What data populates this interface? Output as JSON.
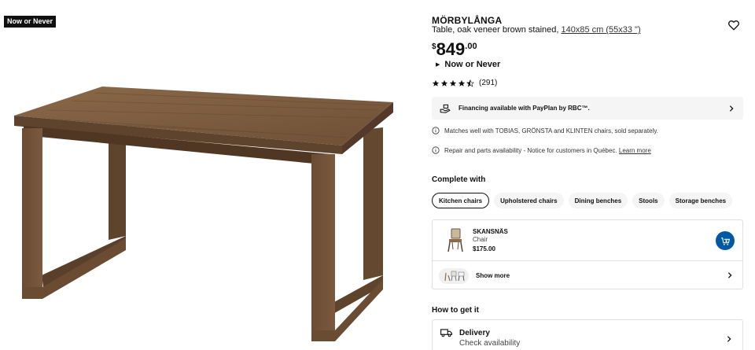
{
  "gallery": {
    "badge": "Now or Never"
  },
  "product": {
    "name": "MÖRBYLÅNGA",
    "description": "Table, oak veneer brown stained, ",
    "measure": "140x85 cm (55x33 \")",
    "price_currency": "$",
    "price_integer": "849",
    "price_decimal": ".00",
    "offer_label": "Now or Never",
    "rating_value": 4.5,
    "rating_count": "(291)"
  },
  "financing": {
    "label": "Financing available with PayPlan by RBC™."
  },
  "notes": {
    "matches": "Matches well with TOBIAS, GRÖNSTA and KLINTEN chairs, sold separately.",
    "repair": "Repair and parts availability - Notice for customers in Québec. ",
    "repair_link": "Learn more"
  },
  "complete_with": {
    "title": "Complete with",
    "chips": [
      "Kitchen chairs",
      "Upholstered chairs",
      "Dining benches",
      "Stools",
      "Storage benches"
    ],
    "active_chip": "Kitchen chairs",
    "item": {
      "name": "SKANSNÄS",
      "type": "Chair",
      "price": "$175.00"
    },
    "show_more": "Show more"
  },
  "how_to_get": {
    "title": "How to get it",
    "delivery_title": "Delivery",
    "delivery_sub": "Check availability"
  },
  "colors": {
    "accent_blue": "#0058a3",
    "badge_bg": "#111111",
    "panel_bg": "#f5f5f5"
  },
  "icons": [
    "heart-icon",
    "star-icon",
    "hand-cash-icon",
    "chevron-right-icon",
    "info-icon",
    "cart-add-icon",
    "truck-icon",
    "triangle-right-icon"
  ]
}
